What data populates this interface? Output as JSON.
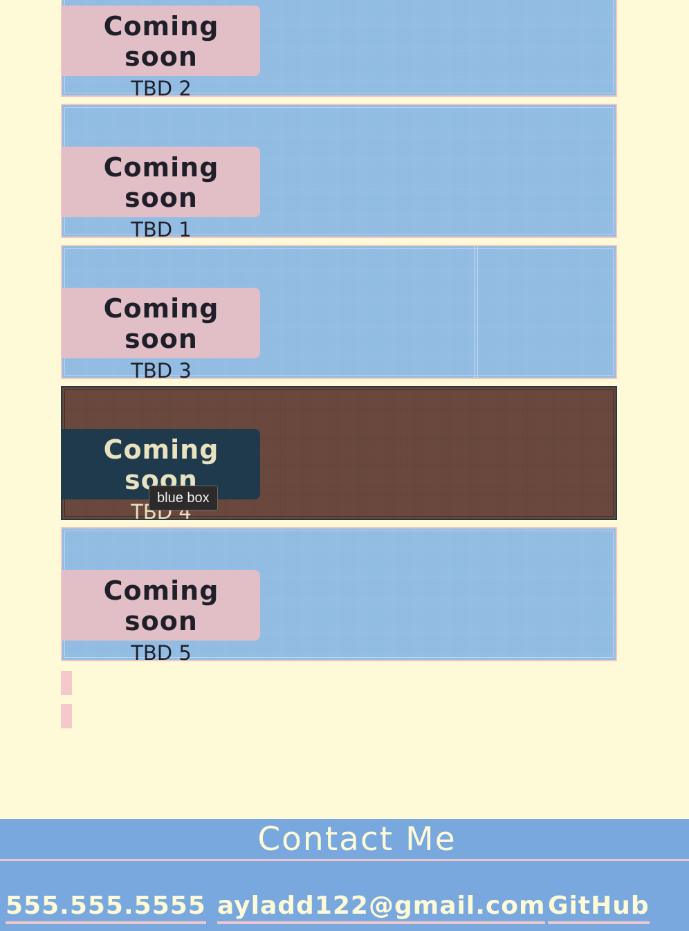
{
  "projects": [
    {
      "title": "Coming soon",
      "subtitle": "TBD 2"
    },
    {
      "title": "Coming soon",
      "subtitle": "TBD 1"
    },
    {
      "title": "Coming soon",
      "subtitle": "TBD 3"
    },
    {
      "title": "Coming soon",
      "subtitle": "TBD 4"
    },
    {
      "title": "Coming soon",
      "subtitle": "TBD 5"
    }
  ],
  "tooltip": "blue box",
  "contact": {
    "title": "Contact Me",
    "phone": "555.555.5555",
    "email": "ayladd122@gmail.com",
    "github": "GitHub"
  },
  "colors": {
    "page_background": "#fefad7",
    "project_card": "#8fbae2",
    "project_card_hover": "#6d4a3f",
    "label_box": "#e2bfc6",
    "label_box_hover": "#1e3a4c",
    "contact_background": "#78a8dd",
    "accent_pink": "#f0c6cd"
  }
}
